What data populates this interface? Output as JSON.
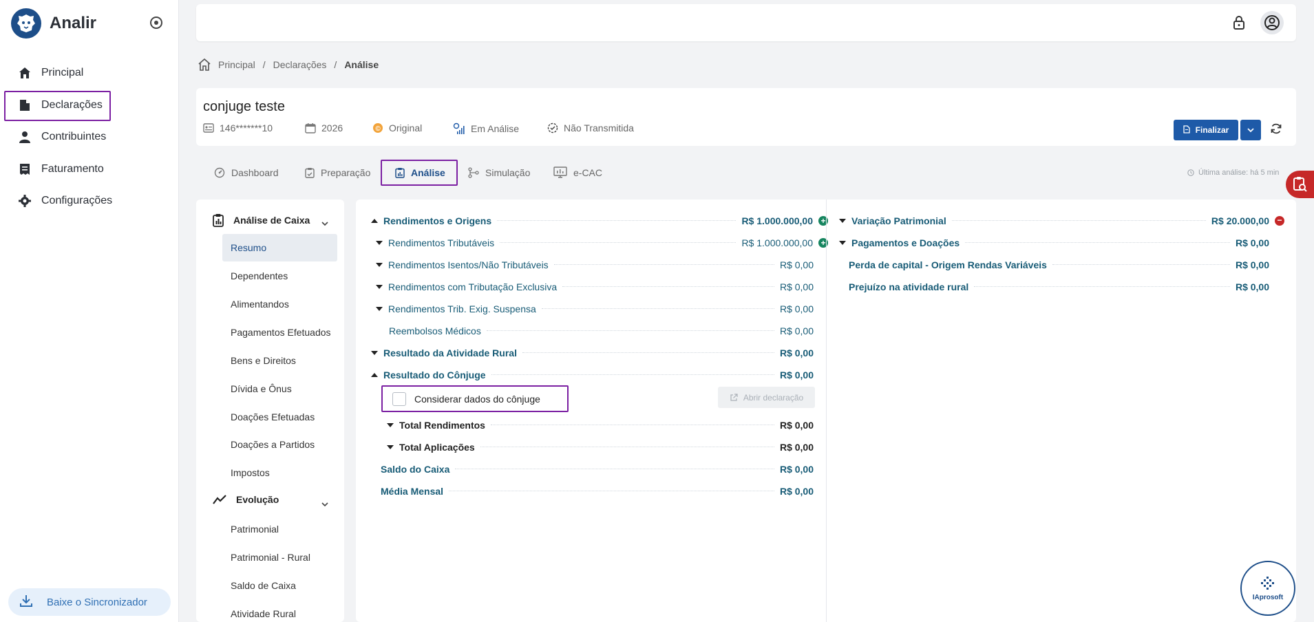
{
  "app": {
    "name": "Analir"
  },
  "sidebar": {
    "items": [
      {
        "label": "Principal",
        "icon": "home-icon"
      },
      {
        "label": "Declarações",
        "icon": "file-icon"
      },
      {
        "label": "Contribuintes",
        "icon": "person-icon"
      },
      {
        "label": "Faturamento",
        "icon": "receipt-icon"
      },
      {
        "label": "Configurações",
        "icon": "gear-icon"
      }
    ],
    "sync_label": "Baixe o Sincronizador"
  },
  "breadcrumb": {
    "home": "Principal",
    "section": "Declarações",
    "current": "Análise"
  },
  "header": {
    "title": "conjuge teste",
    "cpf": "146*******10",
    "year": "2026",
    "type": "Original",
    "status": "Em Análise",
    "transmission": "Não Transmitida",
    "finalize_label": "Finalizar"
  },
  "tabs": [
    {
      "label": "Dashboard"
    },
    {
      "label": "Preparação"
    },
    {
      "label": "Análise"
    },
    {
      "label": "Simulação"
    },
    {
      "label": "e-CAC"
    }
  ],
  "last_analysis": "Última análise: há 5 min",
  "leftnav": {
    "group1": {
      "label": "Análise de Caixa",
      "items": [
        "Resumo",
        "Dependentes",
        "Alimentandos",
        "Pagamentos Efetuados",
        "Bens e Direitos",
        "Dívida e Ônus",
        "Doações Efetuadas",
        "Doações a Partidos",
        "Impostos"
      ]
    },
    "group2": {
      "label": "Evolução",
      "items": [
        "Patrimonial",
        "Patrimonial - Rural",
        "Saldo de Caixa",
        "Atividade Rural"
      ]
    }
  },
  "analysis": {
    "rendimentos_origens": {
      "label": "Rendimentos e Origens",
      "value": "R$ 1.000.000,00"
    },
    "rend_tributaveis": {
      "label": "Rendimentos Tributáveis",
      "value": "R$ 1.000.000,00"
    },
    "rend_isentos": {
      "label": "Rendimentos Isentos/Não Tributáveis",
      "value": "R$ 0,00"
    },
    "rend_exclusiva": {
      "label": "Rendimentos com Tributação Exclusiva",
      "value": "R$ 0,00"
    },
    "rend_suspensa": {
      "label": "Rendimentos Trib. Exig. Suspensa",
      "value": "R$ 0,00"
    },
    "reembolsos": {
      "label": "Reembolsos Médicos",
      "value": "R$ 0,00"
    },
    "atividade_rural": {
      "label": "Resultado da Atividade Rural",
      "value": "R$ 0,00"
    },
    "resultado_conjuge": {
      "label": "Resultado do Cônjuge",
      "value": "R$ 0,00"
    },
    "considerar_label": "Considerar dados do cônjuge",
    "abrir_label": "Abrir declaração",
    "total_rendimentos": {
      "label": "Total Rendimentos",
      "value": "R$ 0,00"
    },
    "total_aplicacoes": {
      "label": "Total Aplicações",
      "value": "R$ 0,00"
    },
    "saldo_caixa": {
      "label": "Saldo do Caixa",
      "value": "R$ 0,00"
    },
    "media_mensal": {
      "label": "Média Mensal",
      "value": "R$ 0,00"
    },
    "variacao": {
      "label": "Variação Patrimonial",
      "value": "R$ 20.000,00"
    },
    "pagamentos": {
      "label": "Pagamentos e Doações",
      "value": "R$ 0,00"
    },
    "perda_capital": {
      "label": "Perda de capital - Origem Rendas Variáveis",
      "value": "R$ 0,00"
    },
    "prejuizo_rural": {
      "label": "Prejuízo na atividade rural",
      "value": "R$ 0,00"
    }
  },
  "badge": {
    "label": "IAprosoft"
  },
  "colors": {
    "primary": "#1e5aa8",
    "teal": "#175b76",
    "positive": "#16855f",
    "negative": "#c62828",
    "highlight": "#7b1fa2"
  }
}
